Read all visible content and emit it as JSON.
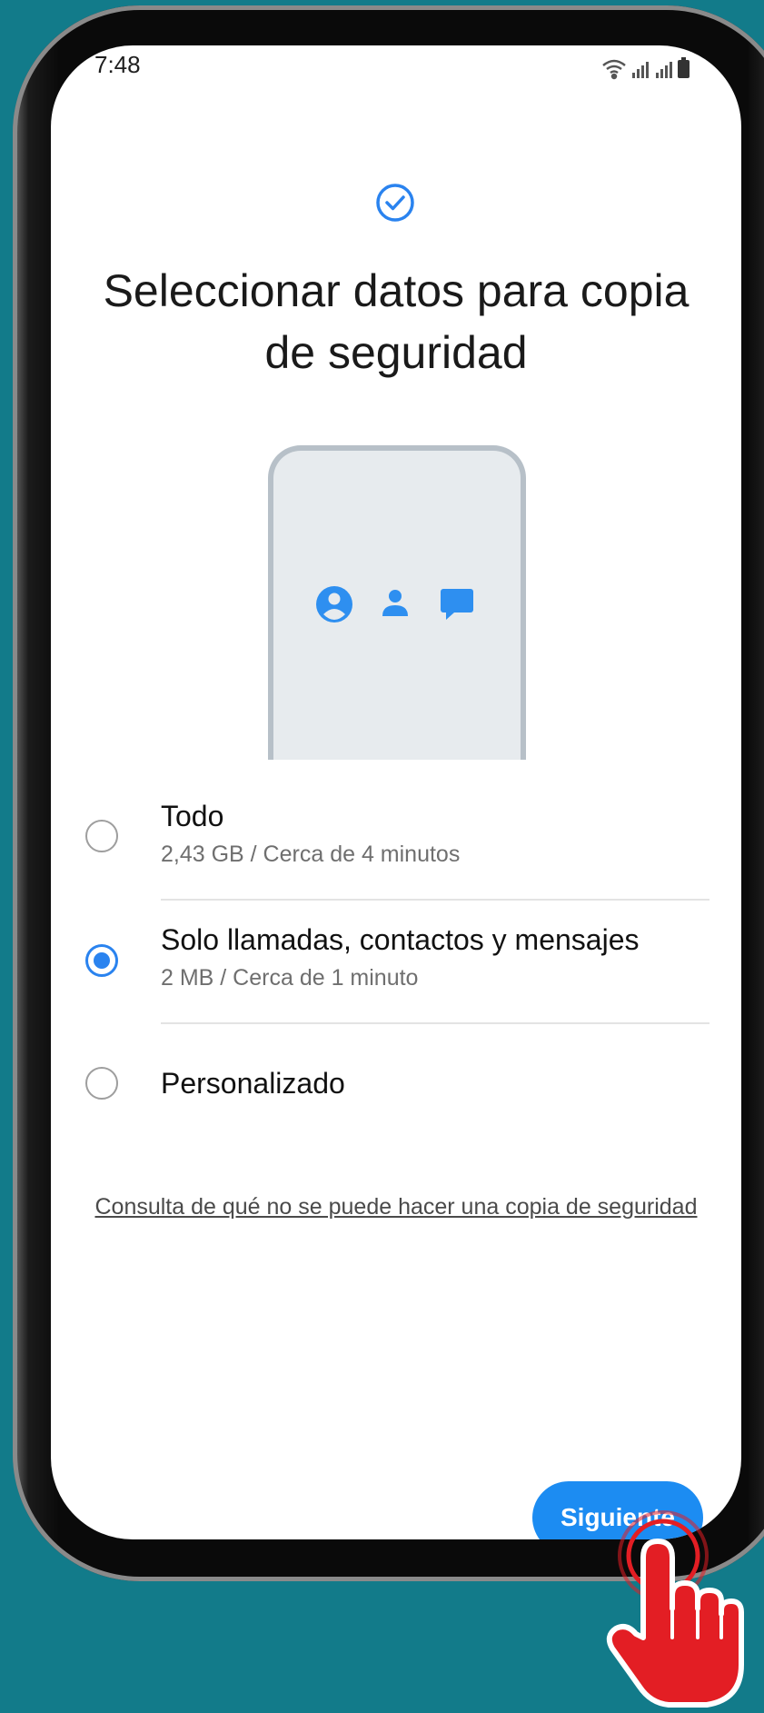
{
  "status_bar": {
    "time": "7:48",
    "icons": [
      "wifi-icon",
      "signal-icon",
      "signal-icon",
      "battery-icon"
    ]
  },
  "header": {
    "icon": "check-circle-icon",
    "title": "Seleccionar datos para copia de seguridad"
  },
  "illustration": {
    "icons": [
      "account-circle-icon",
      "person-icon",
      "message-icon"
    ]
  },
  "options": [
    {
      "title": "Todo",
      "subtitle": "2,43 GB / Cerca de 4 minutos",
      "selected": false
    },
    {
      "title": "Solo llamadas, contactos y mensajes",
      "subtitle": "2 MB / Cerca de 1 minuto",
      "selected": true
    },
    {
      "title": "Personalizado",
      "subtitle": "",
      "selected": false
    }
  ],
  "help_link": "Consulta de qué no se puede hacer una copia de seguridad",
  "next_button": "Siguiente",
  "colors": {
    "background": "#127b8a",
    "accent": "#2a83ef",
    "button": "#1c8cf2",
    "tap_indicator": "#e31e24"
  }
}
